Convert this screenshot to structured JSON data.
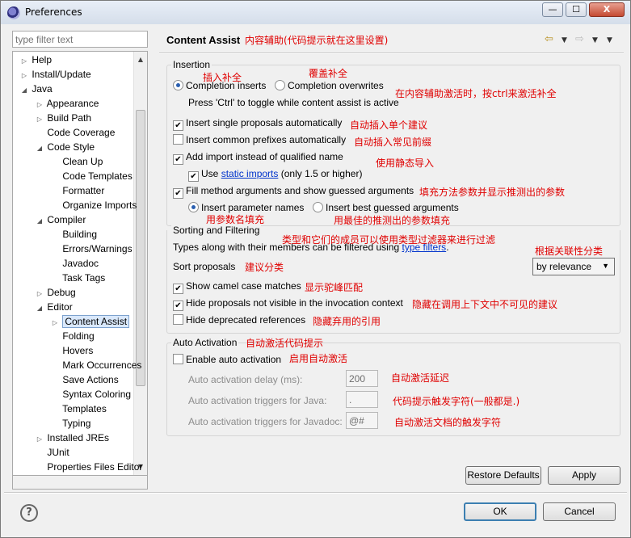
{
  "window": {
    "title": "Preferences",
    "buttons": {
      "minimize": "—",
      "maximize": "☐",
      "close": "X"
    }
  },
  "filter": {
    "placeholder": "type filter text"
  },
  "tree": [
    {
      "label": "Help",
      "depth": 0,
      "twisty": "closed"
    },
    {
      "label": "Install/Update",
      "depth": 0,
      "twisty": "closed"
    },
    {
      "label": "Java",
      "depth": 0,
      "twisty": "open"
    },
    {
      "label": "Appearance",
      "depth": 1,
      "twisty": "closed"
    },
    {
      "label": "Build Path",
      "depth": 1,
      "twisty": "closed"
    },
    {
      "label": "Code Coverage",
      "depth": 1,
      "twisty": "none"
    },
    {
      "label": "Code Style",
      "depth": 1,
      "twisty": "open"
    },
    {
      "label": "Clean Up",
      "depth": 2,
      "twisty": "none"
    },
    {
      "label": "Code Templates",
      "depth": 2,
      "twisty": "none"
    },
    {
      "label": "Formatter",
      "depth": 2,
      "twisty": "none"
    },
    {
      "label": "Organize Imports",
      "depth": 2,
      "twisty": "none"
    },
    {
      "label": "Compiler",
      "depth": 1,
      "twisty": "open"
    },
    {
      "label": "Building",
      "depth": 2,
      "twisty": "none"
    },
    {
      "label": "Errors/Warnings",
      "depth": 2,
      "twisty": "none"
    },
    {
      "label": "Javadoc",
      "depth": 2,
      "twisty": "none"
    },
    {
      "label": "Task Tags",
      "depth": 2,
      "twisty": "none"
    },
    {
      "label": "Debug",
      "depth": 1,
      "twisty": "closed"
    },
    {
      "label": "Editor",
      "depth": 1,
      "twisty": "open"
    },
    {
      "label": "Content Assist",
      "depth": 2,
      "twisty": "closed",
      "selected": true
    },
    {
      "label": "Folding",
      "depth": 2,
      "twisty": "none"
    },
    {
      "label": "Hovers",
      "depth": 2,
      "twisty": "none"
    },
    {
      "label": "Mark Occurrences",
      "depth": 2,
      "twisty": "none"
    },
    {
      "label": "Save Actions",
      "depth": 2,
      "twisty": "none"
    },
    {
      "label": "Syntax Coloring",
      "depth": 2,
      "twisty": "none"
    },
    {
      "label": "Templates",
      "depth": 2,
      "twisty": "none"
    },
    {
      "label": "Typing",
      "depth": 2,
      "twisty": "none"
    },
    {
      "label": "Installed JREs",
      "depth": 1,
      "twisty": "closed"
    },
    {
      "label": "JUnit",
      "depth": 1,
      "twisty": "none"
    },
    {
      "label": "Properties Files Editor",
      "depth": 1,
      "twisty": "none"
    }
  ],
  "page": {
    "title": "Content Assist",
    "title_note": "内容辅助(代码提示就在这里设置)"
  },
  "insertion": {
    "legend": "Insertion",
    "completion_inserts": "Completion inserts",
    "completion_overwrites": "Completion overwrites",
    "toggle_hint": "Press 'Ctrl' to toggle while content assist is active",
    "insert_single": "Insert single proposals automatically",
    "insert_common": "Insert common prefixes automatically",
    "add_import": "Add import instead of qualified name",
    "use_label": "Use",
    "static_imports": "static imports",
    "static_suffix": "(only 1.5 or higher)",
    "fill_args": "Fill method arguments and show guessed arguments",
    "insert_param_names": "Insert parameter names",
    "insert_best_guessed": "Insert best guessed arguments",
    "checked": {
      "insert_single": true,
      "insert_common": false,
      "add_import": true,
      "static_imports": true,
      "fill_args": true
    }
  },
  "sorting": {
    "legend": "Sorting and Filtering",
    "filter_text": "Types along with their members can be filtered using",
    "type_filters": "type filters",
    "sort_label": "Sort proposals",
    "sort_value": "by relevance",
    "camel_case": "Show camel case matches",
    "hide_not_visible": "Hide proposals not visible in the invocation context",
    "hide_deprecated": "Hide deprecated references",
    "checked": {
      "camel_case": true,
      "hide_not_visible": true,
      "hide_deprecated": false
    }
  },
  "auto": {
    "legend": "Auto Activation",
    "enable": "Enable auto activation",
    "enabled": false,
    "delay_label": "Auto activation delay (ms):",
    "delay_value": "200",
    "java_label": "Auto activation triggers for Java:",
    "java_value": ".",
    "javadoc_label": "Auto activation triggers for Javadoc:",
    "javadoc_value": "@#"
  },
  "annotations": {
    "insert_completion": "插入补全",
    "overwrite_completion": "覆盖补全",
    "ctrl_toggle": "在内容辅助激活时，按ctrl来激活补全",
    "insert_single": "自动插入单个建议",
    "insert_common": "自动插入常见前缀",
    "static_import": "使用静态导入",
    "fill_args": "填充方法参数并显示推测出的参数",
    "param_names": "用参数名填充",
    "best_guessed": "用最佳的推测出的参数填充",
    "type_filter": "类型和它们的成员可以使用类型过滤器来进行过滤",
    "by_relevance": "根据关联性分类",
    "sort": "建议分类",
    "camel": "显示驼峰匹配",
    "hide_invisible": "隐藏在调用上下文中不可见的建议",
    "hide_deprecated": "隐藏弃用的引用",
    "auto_activation": "自动激活代码提示",
    "enable_auto": "启用自动激活",
    "delay": "自动激活延迟",
    "java_trigger": "代码提示触发字符(一般都是.)",
    "javadoc_trigger": "自动激活文档的触发字符"
  },
  "buttons": {
    "restore_defaults": "Restore Defaults",
    "apply": "Apply",
    "ok": "OK",
    "cancel": "Cancel"
  },
  "icons": {
    "back": "back-arrow-icon",
    "forward": "forward-arrow-icon",
    "menu": "view-menu-icon",
    "help": "help-icon"
  }
}
